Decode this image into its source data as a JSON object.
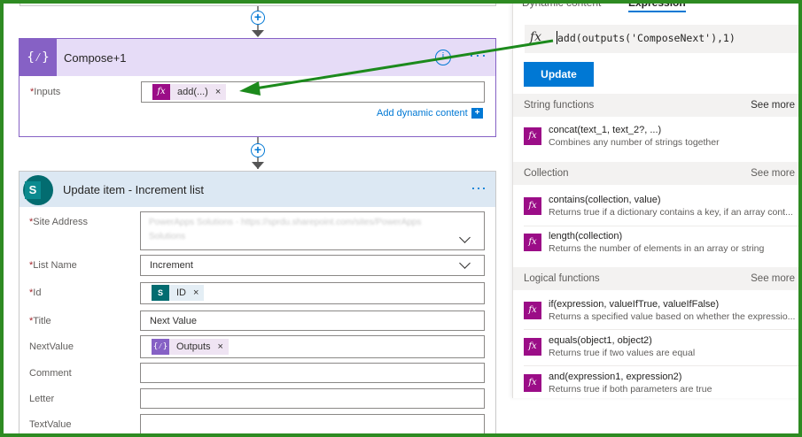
{
  "colors": {
    "frame": "#2e8b22",
    "compose_accent": "#8661c5",
    "compose_header_bg": "#e6dcf7",
    "sharepoint_header_bg": "#dce8f3",
    "function_icon": "#9b0d87",
    "primary_blue": "#0078d4",
    "annotation_arrow": "#1c8a1c"
  },
  "icons": {
    "add_step": "+",
    "compose": "{⁄}",
    "info": "i",
    "more": "···",
    "fx": "fx",
    "remove": "×",
    "add_dynamic": "+",
    "sharepoint": "S"
  },
  "compose": {
    "title": "Compose+1",
    "inputs_label": "Inputs",
    "required_mark": "*",
    "token_label": "add(...)",
    "add_dynamic_label": "Add dynamic content"
  },
  "update_item": {
    "title": "Update item - Increment list",
    "fields": {
      "site_address": {
        "label": "Site Address",
        "required": "*",
        "value_line1": "PowerApps Solutions - https://sprdu.sharepoint.com/sites/PowerApps",
        "value_line2": "Solutions"
      },
      "list_name": {
        "label": "List Name",
        "required": "*",
        "value": "Increment"
      },
      "id": {
        "label": "Id",
        "required": "*",
        "token": "ID"
      },
      "title": {
        "label": "Title",
        "required": "*",
        "value": "Next Value"
      },
      "next_value": {
        "label": "NextValue",
        "token": "Outputs"
      },
      "comment": {
        "label": "Comment"
      },
      "letter": {
        "label": "Letter"
      },
      "text_value": {
        "label": "TextValue"
      }
    }
  },
  "panel": {
    "tabs": [
      "Dynamic content",
      "Expression"
    ],
    "active_tab": "Expression",
    "expression": "add(outputs('ComposeNext'),1)",
    "update_button": "Update",
    "sections": [
      {
        "label": "String functions",
        "see_more": "See more",
        "items": [
          {
            "name": "concat(text_1, text_2?, ...)",
            "desc": "Combines any number of strings together"
          }
        ]
      },
      {
        "label": "Collection",
        "see_more": "See more",
        "items": [
          {
            "name": "contains(collection, value)",
            "desc": "Returns true if a dictionary contains a key, if an array cont..."
          },
          {
            "name": "length(collection)",
            "desc": "Returns the number of elements in an array or string"
          }
        ]
      },
      {
        "label": "Logical functions",
        "see_more": "See more",
        "items": [
          {
            "name": "if(expression, valueIfTrue, valueIfFalse)",
            "desc": "Returns a specified value based on whether the expressio..."
          },
          {
            "name": "equals(object1, object2)",
            "desc": "Returns true if two values are equal"
          },
          {
            "name": "and(expression1, expression2)",
            "desc": "Returns true if both parameters are true"
          }
        ]
      }
    ]
  }
}
